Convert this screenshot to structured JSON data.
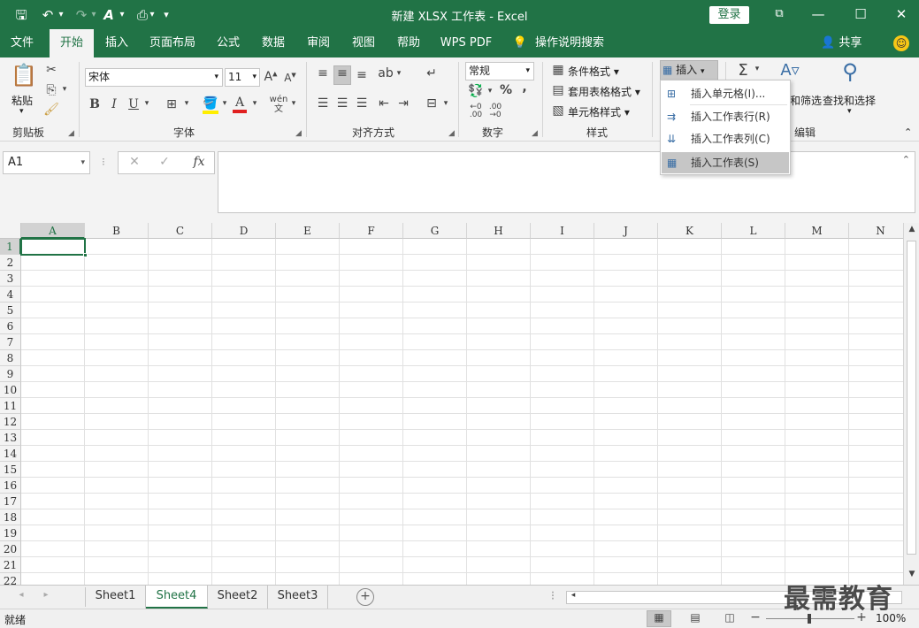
{
  "titlebar": {
    "title": "新建 XLSX 工作表 - Excel",
    "login_label": "登录",
    "qa_save": "🖫",
    "qa_undo": "↶",
    "qa_redo": "↷",
    "qa_more": "▾"
  },
  "menu": {
    "tabs": [
      "文件",
      "开始",
      "插入",
      "页面布局",
      "公式",
      "数据",
      "审阅",
      "视图",
      "帮助",
      "WPS PDF",
      "操作说明搜索"
    ],
    "active_tab": "开始",
    "share_label": "共享"
  },
  "ribbon": {
    "clipboard": {
      "paste_label": "粘贴",
      "group_label": "剪贴板"
    },
    "font": {
      "font_name": "宋体",
      "font_size": "11",
      "bold": "B",
      "italic": "I",
      "underline": "U",
      "group_label": "字体"
    },
    "alignment": {
      "group_label": "对齐方式"
    },
    "number": {
      "format": "常规",
      "percent": "%",
      "comma": ",",
      "group_label": "数字"
    },
    "styles": {
      "conditional": "条件格式",
      "table_format": "套用表格格式",
      "cell_styles": "单元格样式",
      "group_label": "样式"
    },
    "cells": {
      "insert_label": "插入"
    },
    "editing": {
      "sum_symbol": "Σ",
      "sort_filter": "和筛选",
      "find_select": "查找和选择",
      "group_label": "编辑"
    }
  },
  "insert_menu": {
    "items": [
      "插入单元格(I)...",
      "插入工作表行(R)",
      "插入工作表列(C)",
      "插入工作表(S)"
    ],
    "hover_index": 3
  },
  "formula_bar": {
    "name_box": "A1",
    "cancel": "✕",
    "enter": "✓",
    "fx": "fx",
    "value": ""
  },
  "grid": {
    "columns": [
      "A",
      "B",
      "C",
      "D",
      "E",
      "F",
      "G",
      "H",
      "I",
      "J",
      "K",
      "L",
      "M",
      "N"
    ],
    "rows": [
      "1",
      "2",
      "3",
      "4",
      "5",
      "6",
      "7",
      "8",
      "9",
      "10",
      "11",
      "12",
      "13",
      "14",
      "15",
      "16",
      "17",
      "18",
      "19",
      "20",
      "21",
      "22"
    ],
    "active_cell": "A1"
  },
  "sheets": {
    "tabs": [
      "Sheet1",
      "Sheet4",
      "Sheet2",
      "Sheet3"
    ],
    "active": "Sheet4",
    "add_symbol": "+"
  },
  "status": {
    "mode": "就绪",
    "zoom": "100%"
  },
  "watermark": "最需教育",
  "colors": {
    "accent": "#217346",
    "ribbon_bg": "#f3f3f3"
  }
}
